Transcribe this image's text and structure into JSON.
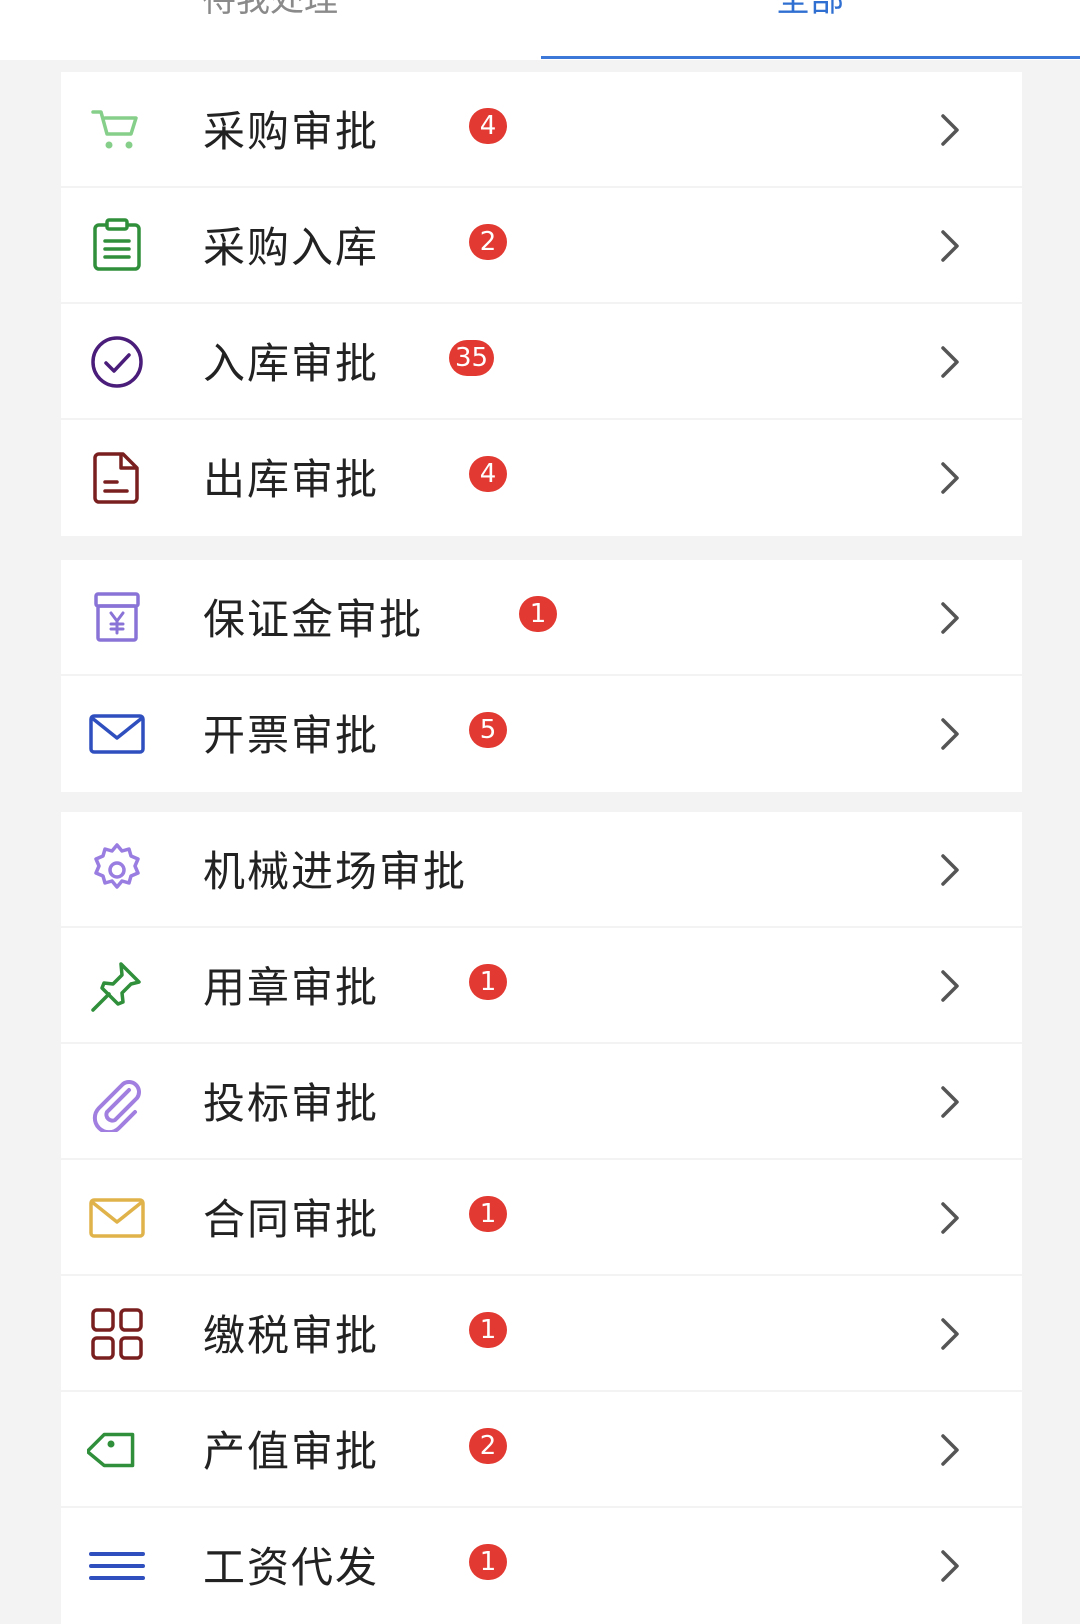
{
  "tabs": [
    {
      "label": "待我处理",
      "active": false
    },
    {
      "label": "全部",
      "active": true
    }
  ],
  "colors": {
    "accent": "#3b78d8",
    "badge": "#e23a32"
  },
  "groups": [
    {
      "items": [
        {
          "label": "采购审批",
          "badge": "4",
          "icon": "cart-icon"
        },
        {
          "label": "采购入库",
          "badge": "2",
          "icon": "clipboard-icon"
        },
        {
          "label": "入库审批",
          "badge": "35",
          "icon": "check-circle-icon"
        },
        {
          "label": "出库审批",
          "badge": "4",
          "icon": "document-icon"
        }
      ]
    },
    {
      "items": [
        {
          "label": "保证金审批",
          "badge": "1",
          "icon": "yen-box-icon"
        },
        {
          "label": "开票审批",
          "badge": "5",
          "icon": "envelope-icon"
        }
      ]
    },
    {
      "items": [
        {
          "label": "机械进场审批",
          "badge": "",
          "icon": "gear-icon"
        },
        {
          "label": "用章审批",
          "badge": "1",
          "icon": "pin-icon"
        },
        {
          "label": "投标审批",
          "badge": "",
          "icon": "paperclip-icon"
        },
        {
          "label": "合同审批",
          "badge": "1",
          "icon": "mail-icon"
        },
        {
          "label": "缴税审批",
          "badge": "1",
          "icon": "grid-icon"
        },
        {
          "label": "产值审批",
          "badge": "2",
          "icon": "tag-icon"
        },
        {
          "label": "工资代发",
          "badge": "1",
          "icon": "menu-icon"
        }
      ]
    }
  ]
}
